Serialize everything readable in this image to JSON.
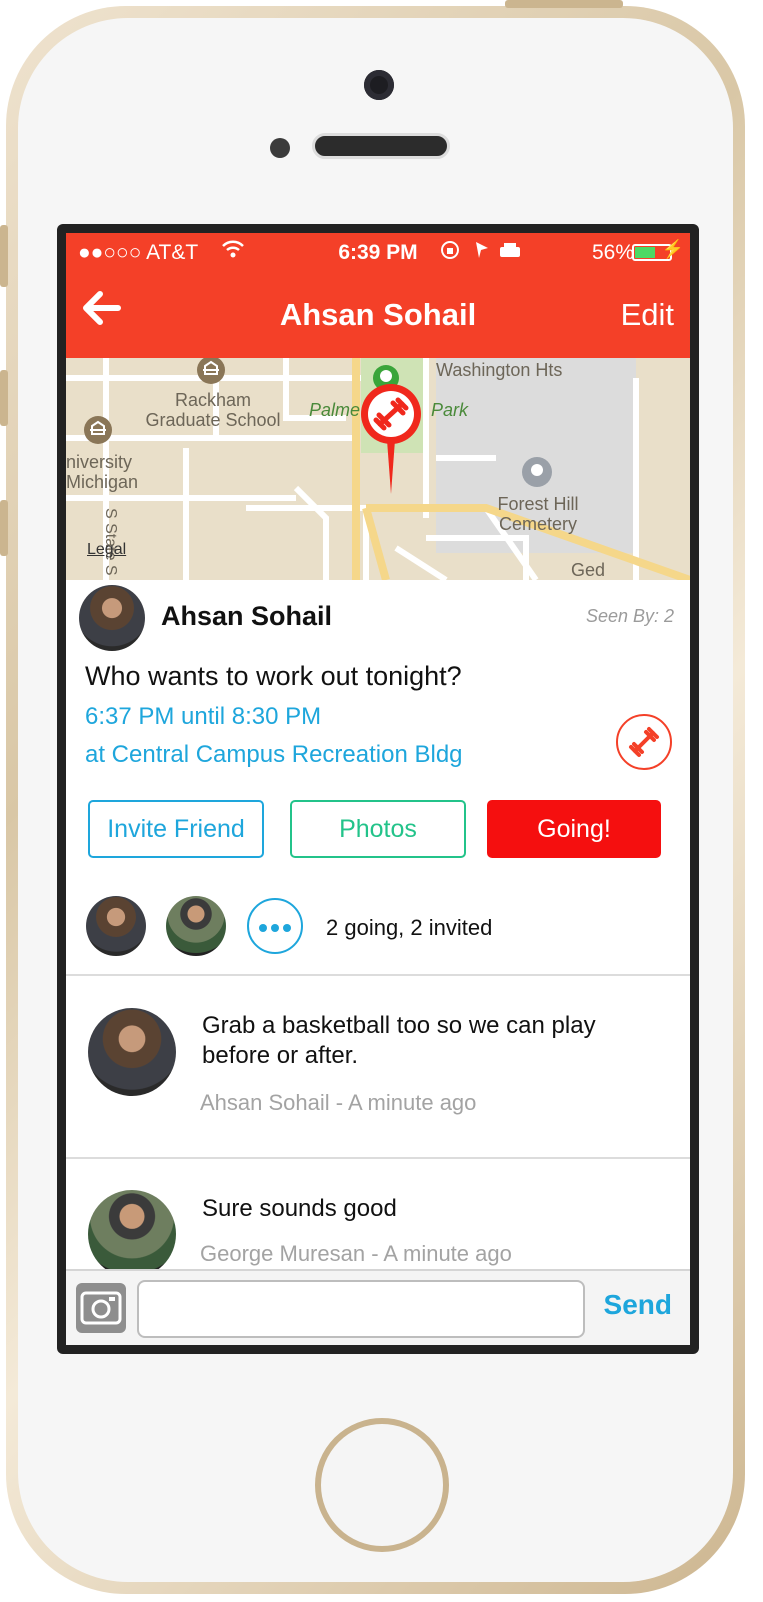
{
  "status": {
    "carrier": "●●○○○ AT&T",
    "time": "6:39 PM",
    "battery_pct": "56%"
  },
  "nav": {
    "title": "Ahsan Sohail",
    "edit_label": "Edit"
  },
  "map": {
    "labels": {
      "rackham": "Rackham\nGraduate School",
      "university": "niversity\nMichigan",
      "washington": "Washington Hts",
      "palmer_a": "Palme",
      "palmer_b": "Park",
      "forest": "Forest Hill\nCemetery",
      "state": "S State S",
      "legal": "Legal",
      "geddes": "Ged"
    }
  },
  "post": {
    "author": "Ahsan Sohail",
    "seen_by": "Seen By: 2",
    "headline": "Who wants to work out tonight?",
    "time_range": "6:37 PM until 8:30 PM",
    "location": "at Central Campus Recreation Bldg"
  },
  "actions": {
    "invite": "Invite Friend",
    "photos": "Photos",
    "going": "Going!"
  },
  "attendees": {
    "summary": "2 going, 2 invited"
  },
  "comments": [
    {
      "text": "Grab a basketball too so we can play before or after.",
      "meta": "Ahsan Sohail - A minute ago"
    },
    {
      "text": "Sure sounds good",
      "meta": "George Muresan - A minute ago"
    }
  ],
  "composer": {
    "send_label": "Send",
    "placeholder": ""
  },
  "colors": {
    "accent_red": "#f44028",
    "link_blue": "#1ea6dc",
    "photos_green": "#23c38a",
    "going_red": "#f50f0f"
  }
}
